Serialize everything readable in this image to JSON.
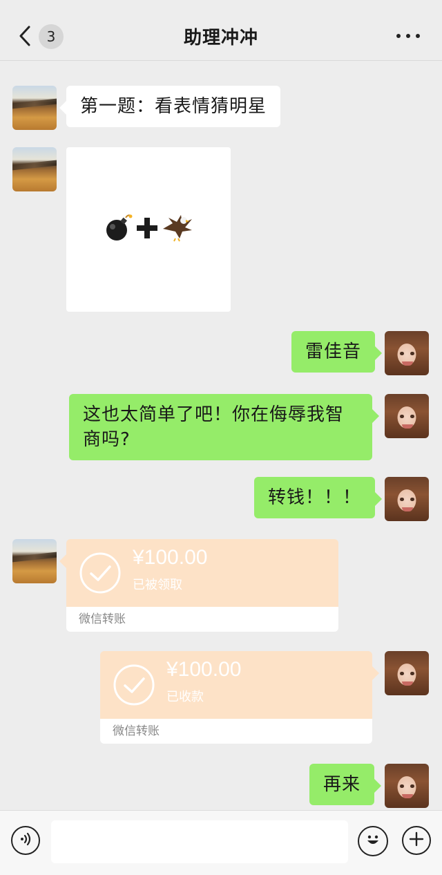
{
  "header": {
    "back_icon": "chevron-left-icon",
    "unread_count": "3",
    "title": "助理冲冲",
    "more_icon": "more-dots-icon"
  },
  "messages": [
    {
      "side": "left",
      "type": "text",
      "avatar": "desert-avatar",
      "text": "第一题：看表情猜明星"
    },
    {
      "side": "left",
      "type": "image",
      "avatar": "desert-avatar",
      "emojis": [
        "💣",
        "➕",
        "🦅"
      ]
    },
    {
      "side": "right",
      "type": "text",
      "avatar": "girl-avatar",
      "text": "雷佳音"
    },
    {
      "side": "right",
      "type": "text",
      "avatar": "girl-avatar",
      "text": "这也太简单了吧！你在侮辱我智商吗?"
    },
    {
      "side": "right",
      "type": "text",
      "avatar": "girl-avatar",
      "text": "转钱！！！"
    },
    {
      "side": "left",
      "type": "transfer",
      "avatar": "desert-avatar",
      "amount": "¥100.00",
      "status": "已被领取",
      "footer": "微信转账"
    },
    {
      "side": "right",
      "type": "transfer",
      "avatar": "girl-avatar",
      "amount": "¥100.00",
      "status": "已收款",
      "footer": "微信转账"
    },
    {
      "side": "right",
      "type": "text",
      "avatar": "girl-avatar",
      "text": "再来"
    }
  ],
  "input_bar": {
    "voice_icon": "voice-icon",
    "text_value": "",
    "emoji_icon": "emoji-icon",
    "plus_icon": "plus-icon"
  },
  "colors": {
    "background": "#ededed",
    "bubble_self": "#95ec69",
    "bubble_other": "#ffffff",
    "transfer": "#fde2c7"
  }
}
